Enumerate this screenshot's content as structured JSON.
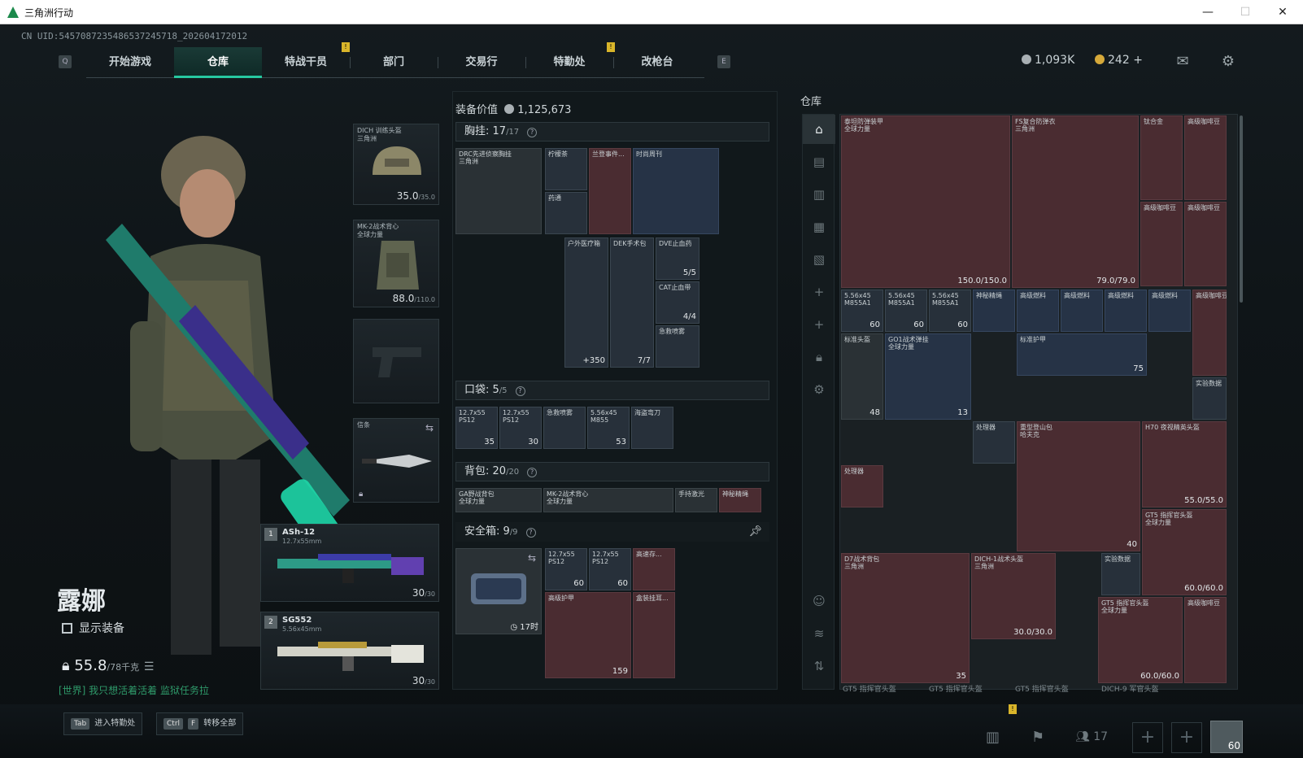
{
  "window": {
    "title": "三角洲行动",
    "min": "—",
    "max": "☐",
    "close": "✕"
  },
  "uid": "CN UID:5457087235486537245718_202604172012",
  "nav": {
    "keyleft": "Q",
    "keyright": "E",
    "tabs": [
      "开始游戏",
      "仓库",
      "特战干员",
      "部门",
      "交易行",
      "特勤处",
      "改枪台"
    ],
    "active": 1
  },
  "currency": {
    "silver": "1,093K",
    "gold": "242",
    "plus": "+"
  },
  "character": {
    "name": "露娜",
    "show_equip": "显示装备",
    "weight": "55.8",
    "weight_max": "/78千克",
    "chat": "[世界] 我只想活着活着  监狱任务拉",
    "helmet": {
      "label": "DICH 训练头盔\n三角洲",
      "value": "35.0",
      "max": "/35.0"
    },
    "armor": {
      "label": "MK-2战术背心\n全球力量",
      "value": "88.0",
      "max": "/110.0"
    },
    "melee": {
      "label": "信条"
    },
    "gun1": {
      "idx": "1",
      "name": "ASh-12",
      "ammo": "12.7x55mm",
      "value": "30",
      "max": "/30"
    },
    "gun2": {
      "idx": "2",
      "name": "SG552",
      "ammo": "5.56x45mm",
      "value": "30",
      "max": "/30"
    }
  },
  "bottom": {
    "tab_key": "Tab",
    "tab_text": "进入特勤处",
    "ctrl": "Ctrl",
    "f": "F",
    "transfer": "转移全部",
    "friends": "17",
    "level": "60"
  },
  "middle": {
    "equip_value_label": "装备价值",
    "equip_value": "1,125,673",
    "chest": {
      "label": "胸挂:",
      "cur": "17",
      "max": "/17"
    },
    "pocket": {
      "label": "口袋:",
      "cur": "5",
      "max": "/5"
    },
    "backpack": {
      "label": "背包:",
      "cur": "20",
      "max": "/20"
    },
    "safe": {
      "label": "安全箱:",
      "cur": "9",
      "max": "/9",
      "timer": "17时"
    },
    "items": {
      "drc": "DRC先进侦察胸挂\n三角洲",
      "lemon": "柠檬茶",
      "pills": "药通",
      "mag1": "兰登事件...",
      "magazine": "时尚周刊",
      "medkit": "户外医疗箱",
      "medkit_q": "+350",
      "dek": "DEK手术包",
      "dek_q": "7/7",
      "dve": "DVE止血药",
      "dve_q": "5/5",
      "cat": "CAT止血带",
      "cat_q": "4/4",
      "spray": "急救喷雾",
      "p1": "12.7x55\nPS12",
      "p1_q": "35",
      "p2": "12.7x55\nPS12",
      "p2_q": "30",
      "p3": "急救喷雾",
      "p4": "5.56x45\nM855",
      "p4_q": "53",
      "p5": "海盗弯刀",
      "bp1": "GA野战背包\n全球力量",
      "bp2": "MK-2战术背心\n全球力量",
      "bp3": "手持激光",
      "bp4": "神秘精绳",
      "s1": "12.7x55\nPS12",
      "s1_q": "60",
      "s2": "12.7x55\nPS12",
      "s2_q": "60",
      "s3": "高速存...",
      "s4": "高级护甲",
      "s4_q": "159",
      "s5": "盒装挂耳..."
    }
  },
  "right": {
    "title": "仓库",
    "items": [
      {
        "n": "泰坦防弹装甲\n全球力量",
        "q": "150.0/150.0"
      },
      {
        "n": "FS复合防弹衣\n三角洲",
        "q": "79.0/79.0"
      },
      {
        "n": "钛合金",
        "q": ""
      },
      {
        "n": "高级咖啡豆",
        "q": ""
      },
      {
        "n": "高级咖啡豆",
        "q": ""
      },
      {
        "n": "高级咖啡豆",
        "q": ""
      },
      {
        "n": "5.56x45\nM855A1",
        "q": "60"
      },
      {
        "n": "5.56x45\nM855A1",
        "q": "60"
      },
      {
        "n": "5.56x45\nM855A1",
        "q": "60"
      },
      {
        "n": "神秘精绳",
        "q": ""
      },
      {
        "n": "高级燃料",
        "q": ""
      },
      {
        "n": "高级燃料",
        "q": ""
      },
      {
        "n": "高级燃料",
        "q": ""
      },
      {
        "n": "高级燃料",
        "q": ""
      },
      {
        "n": "高级咖啡豆",
        "q": ""
      },
      {
        "n": "标准头盔",
        "q": "48"
      },
      {
        "n": "GO1战术弹挂\n全球力量",
        "q": "13"
      },
      {
        "n": "标准护甲",
        "q": "75"
      },
      {
        "n": "实验数据",
        "q": ""
      },
      {
        "n": "处理器",
        "q": ""
      },
      {
        "n": "重型登山包\n哈夫克",
        "q": "40"
      },
      {
        "n": "H70 夜视精英头盔",
        "q": "55.0/55.0"
      },
      {
        "n": "处理器",
        "q": ""
      },
      {
        "n": "GT5 指挥官头盔\n全球力量",
        "q": "60.0/60.0"
      },
      {
        "n": "D7战术背包\n三角洲",
        "q": "35"
      },
      {
        "n": "DICH-1战术头盔\n三角洲",
        "q": "30.0/30.0"
      },
      {
        "n": "实验数据",
        "q": ""
      },
      {
        "n": "GT5 指挥官头盔\n全球力量",
        "q": "60.0/60.0"
      },
      {
        "n": "高级咖啡豆",
        "q": ""
      }
    ],
    "footer": [
      "GT5 指挥官头盔",
      "GT5 指挥官头盔",
      "GT5 指挥官头盔",
      "DICH-9 军官头盔"
    ]
  }
}
